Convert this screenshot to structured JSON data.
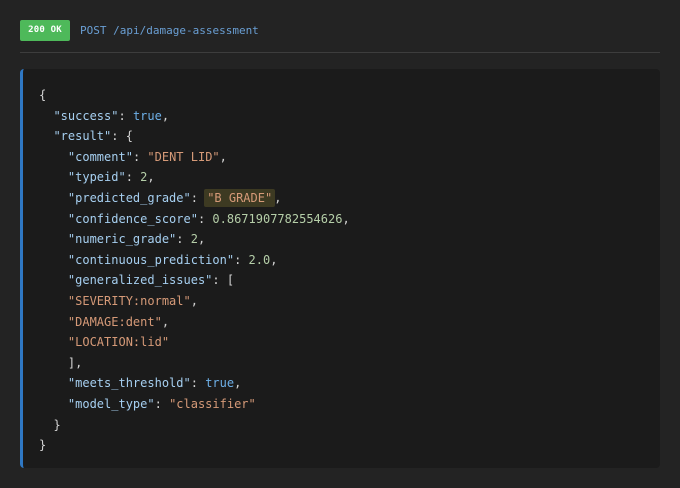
{
  "header": {
    "status_badge": "200 OK",
    "method_path": "POST /api/damage-assessment"
  },
  "response": {
    "success": "true",
    "comment": "\"DENT LID\"",
    "typeid": "2",
    "predicted_grade": "\"B GRADE\"",
    "confidence_score": "0.8671907782554626",
    "numeric_grade": "2",
    "continuous_prediction": "2.0",
    "generalized_issues": [
      "\"SEVERITY:normal\"",
      "\"DAMAGE:dent\"",
      "\"LOCATION:lid\""
    ],
    "meets_threshold": "true",
    "model_type": "\"classifier\""
  },
  "keys": {
    "success": "\"success\"",
    "result": "\"result\"",
    "comment": "\"comment\"",
    "typeid": "\"typeid\"",
    "predicted_grade": "\"predicted_grade\"",
    "confidence_score": "\"confidence_score\"",
    "numeric_grade": "\"numeric_grade\"",
    "continuous_prediction": "\"continuous_prediction\"",
    "generalized_issues": "\"generalized_issues\"",
    "meets_threshold": "\"meets_threshold\"",
    "model_type": "\"model_type\""
  },
  "colors": {
    "status_ok": "#4eb95a",
    "accent_border": "#2f78c4",
    "highlight": "#3d3a22"
  }
}
